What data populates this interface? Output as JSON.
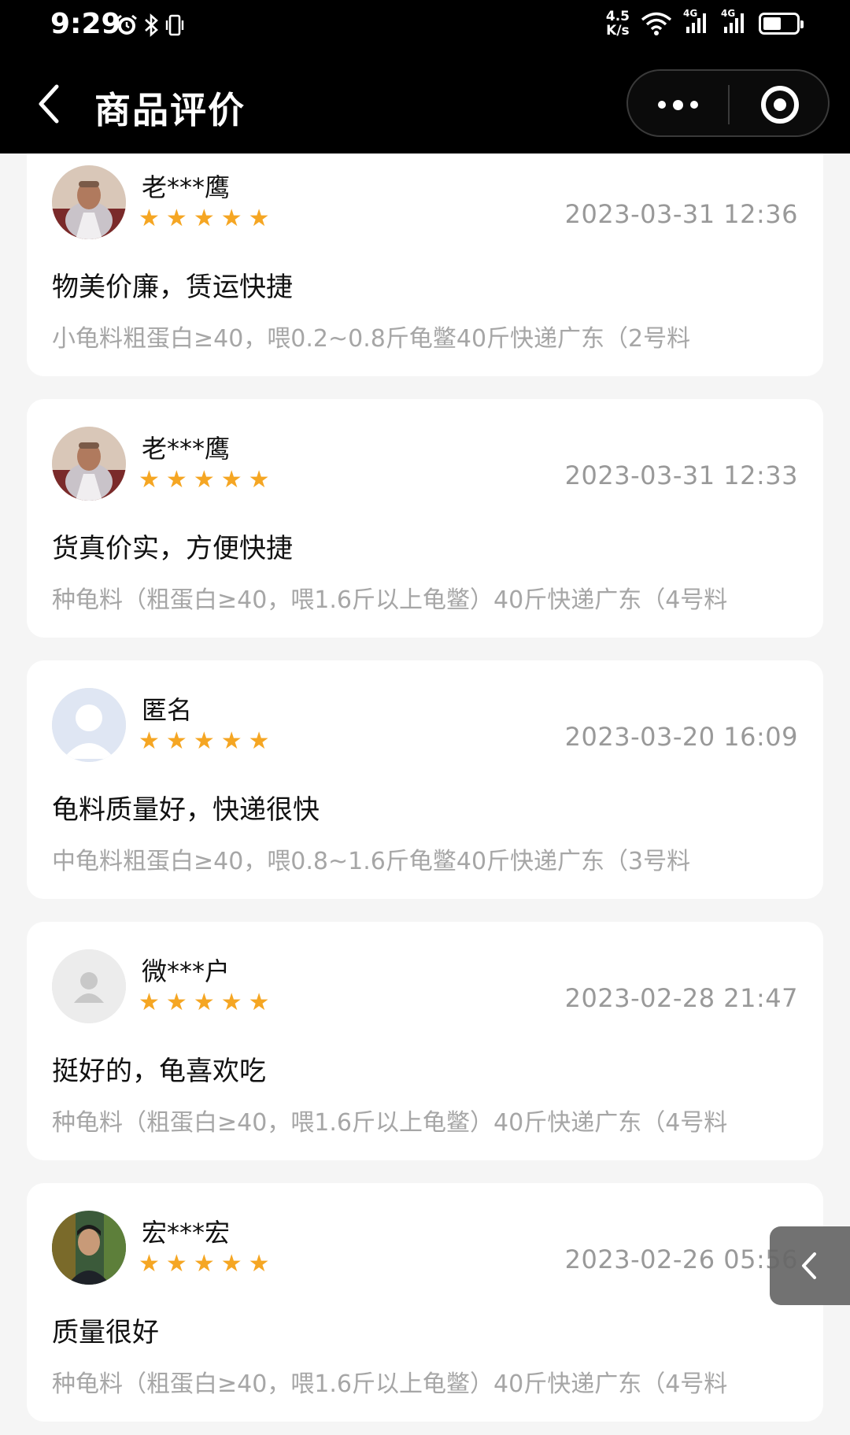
{
  "status_bar": {
    "time": "9:29",
    "speed_value": "4.5",
    "speed_unit": "K/s",
    "network_1": "4G",
    "network_2": "4G",
    "battery_level": 0.55
  },
  "nav": {
    "title": "商品评价"
  },
  "reviews": [
    {
      "username": "老***鹰",
      "rating": 5,
      "date": "2023-03-31 12:36",
      "text": "物美价廉，赁运快捷",
      "spec": "小龟料粗蛋白≥40，喂0.2~0.8斤龟鳖40斤快递广东（2号料",
      "avatar": "photo-man-red"
    },
    {
      "username": "老***鹰",
      "rating": 5,
      "date": "2023-03-31 12:33",
      "text": "货真价实，方便快捷",
      "spec": "种龟料（粗蛋白≥40，喂1.6斤以上龟鳖）40斤快递广东（4号料",
      "avatar": "photo-man-red"
    },
    {
      "username": "匿名",
      "rating": 5,
      "date": "2023-03-20 16:09",
      "text": "龟料质量好，快递很快",
      "spec": "中龟料粗蛋白≥40，喂0.8~1.6斤龟鳖40斤快递广东（3号料",
      "avatar": "default-blue"
    },
    {
      "username": "微***户",
      "rating": 5,
      "date": "2023-02-28 21:47",
      "text": "挺好的，龟喜欢吃",
      "spec": "种龟料（粗蛋白≥40，喂1.6斤以上龟鳖）40斤快递广东（4号料",
      "avatar": "default-gray"
    },
    {
      "username": "宏***宏",
      "rating": 5,
      "date": "2023-02-26 05:56",
      "text": "质量很好",
      "spec": "种龟料（粗蛋白≥40，喂1.6斤以上龟鳖）40斤快递广东（4号料",
      "avatar": "photo-young-man"
    }
  ],
  "colors": {
    "star": "#f5a623",
    "header_bg": "#000000",
    "page_bg": "#f5f5f5",
    "muted_text": "#999999"
  }
}
